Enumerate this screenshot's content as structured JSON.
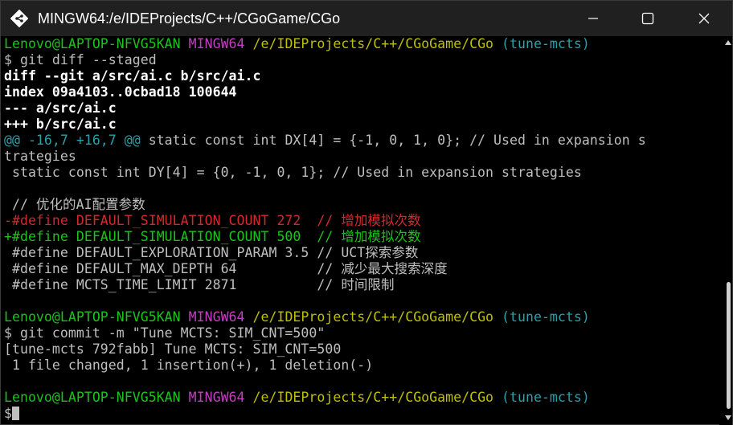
{
  "window": {
    "title": "MINGW64:/e/IDEProjects/C++/CGoGame/CGo",
    "icons": {
      "app": "git-bash-icon",
      "minimize": "minimize-icon",
      "maximize": "maximize-icon",
      "close": "close-icon"
    }
  },
  "colors": {
    "prompt_user": "#1cc31c",
    "prompt_shell": "#bf40bf",
    "prompt_path": "#bfbf00",
    "prompt_branch": "#2aa0a8",
    "diff_removed": "#d02b2b",
    "diff_added": "#1cc31c",
    "hunk_header": "#2aa0a8"
  },
  "terminal": {
    "prompt1": {
      "user": "Lenovo@LAPTOP-NFVG5KAN",
      "shell": "MINGW64",
      "path": "/e/IDEProjects/C++/CGoGame/CGo",
      "branch": "(tune-mcts)"
    },
    "cmd1": "$ git diff --staged",
    "diff_header1": "diff --git a/src/ai.c b/src/ai.c",
    "diff_header2": "index 09a4103..0cbad18 100644",
    "diff_header3": "--- a/src/ai.c",
    "diff_header4": "+++ b/src/ai.c",
    "hunk": {
      "marker": "@@ -16,7 +16,7 @@",
      "context": " static const int DX[4] = {-1, 0, 1, 0}; // Used in expansion s",
      "wrap": "trategies"
    },
    "ctx1": " static const int DY[4] = {0, -1, 0, 1}; // Used in expansion strategies",
    "ctx2": " ",
    "ctx3": " // 优化的AI配置参数",
    "removed": "-#define DEFAULT_SIMULATION_COUNT 272  // 增加模拟次数",
    "added": "+#define DEFAULT_SIMULATION_COUNT 500  // 增加模拟次数",
    "ctx4": " #define DEFAULT_EXPLORATION_PARAM 3.5 // UCT探索参数",
    "ctx5": " #define DEFAULT_MAX_DEPTH 64          // 减少最大搜索深度",
    "ctx6": " #define MCTS_TIME_LIMIT 2871          // 时间限制",
    "prompt2": {
      "user": "Lenovo@LAPTOP-NFVG5KAN",
      "shell": "MINGW64",
      "path": "/e/IDEProjects/C++/CGoGame/CGo",
      "branch": "(tune-mcts)"
    },
    "cmd2": "$ git commit -m \"Tune MCTS: SIM_CNT=500\"",
    "out1": "[tune-mcts 792fabb] Tune MCTS: SIM_CNT=500",
    "out2": " 1 file changed, 1 insertion(+), 1 deletion(-)",
    "prompt3": {
      "user": "Lenovo@LAPTOP-NFVG5KAN",
      "shell": "MINGW64",
      "path": "/e/IDEProjects/C++/CGoGame/CGo",
      "branch": "(tune-mcts)"
    },
    "cmd3": "$"
  }
}
